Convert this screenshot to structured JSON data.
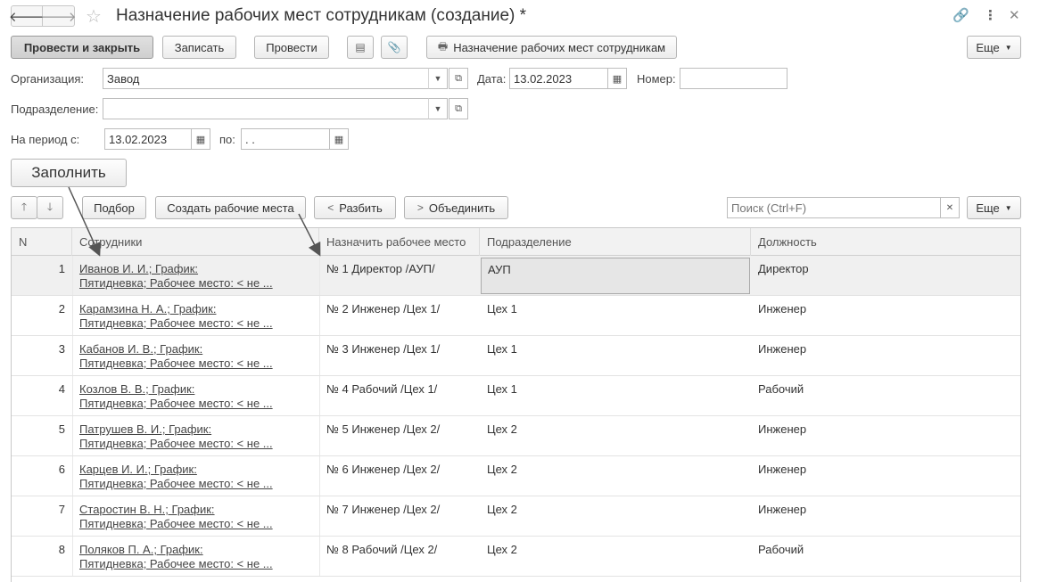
{
  "window": {
    "title": "Назначение рабочих мест сотрудникам (создание) *"
  },
  "toolbar": {
    "post_close": "Провести и закрыть",
    "save": "Записать",
    "post": "Провести",
    "print_report": "Назначение рабочих мест сотрудникам",
    "more": "Еще"
  },
  "form": {
    "org_label": "Организация:",
    "org_value": "Завод",
    "date_label": "Дата:",
    "date_value": "13.02.2023",
    "number_label": "Номер:",
    "number_value": "",
    "dept_label": "Подразделение:",
    "dept_value": "",
    "period_from_label": "На период с:",
    "period_from_value": "13.02.2023",
    "period_to_label": "по:",
    "period_to_value": " .  .",
    "fill_button": "Заполнить"
  },
  "table_toolbar": {
    "pick": "Подбор",
    "create_places": "Создать рабочие места",
    "split": "Разбить",
    "merge": "Объединить",
    "search_placeholder": "Поиск (Ctrl+F)",
    "more": "Еще"
  },
  "table": {
    "headers": [
      "N",
      "Сотрудники",
      "Назначить рабочее место",
      "Подразделение",
      "Должность"
    ],
    "rows": [
      {
        "n": "1",
        "emp1": "Иванов И. И.; График:",
        "emp2": "Пятидневка; Рабочее место: < не ...",
        "place": "№ 1 Директор /АУП/",
        "dept": "АУП",
        "pos": "Директор"
      },
      {
        "n": "2",
        "emp1": "Карамзина Н. А.; График:",
        "emp2": "Пятидневка; Рабочее место: < не ...",
        "place": "№ 2 Инженер /Цех 1/",
        "dept": "Цех 1",
        "pos": "Инженер"
      },
      {
        "n": "3",
        "emp1": "Кабанов И. В.; График:",
        "emp2": "Пятидневка; Рабочее место: < не ...",
        "place": "№ 3 Инженер /Цех 1/",
        "dept": "Цех 1",
        "pos": "Инженер"
      },
      {
        "n": "4",
        "emp1": "Козлов В. В.; График:",
        "emp2": "Пятидневка; Рабочее место: < не ...",
        "place": "№ 4 Рабочий /Цех 1/",
        "dept": "Цех 1",
        "pos": "Рабочий"
      },
      {
        "n": "5",
        "emp1": "Патрушев В. И.; График:",
        "emp2": "Пятидневка; Рабочее место: < не ...",
        "place": "№ 5 Инженер /Цех 2/",
        "dept": "Цех 2",
        "pos": "Инженер"
      },
      {
        "n": "6",
        "emp1": "Карцев И. И.; График:",
        "emp2": "Пятидневка; Рабочее место: < не ...",
        "place": "№ 6 Инженер /Цех 2/",
        "dept": "Цех 2",
        "pos": "Инженер"
      },
      {
        "n": "7",
        "emp1": "Старостин В. Н.; График:",
        "emp2": "Пятидневка; Рабочее место: < не ...",
        "place": "№ 7 Инженер /Цех 2/",
        "dept": "Цех 2",
        "pos": "Инженер"
      },
      {
        "n": "8",
        "emp1": "Поляков П. А.; График:",
        "emp2": "Пятидневка; Рабочее место: < не ...",
        "place": "№ 8 Рабочий /Цех 2/",
        "dept": "Цех 2",
        "pos": "Рабочий"
      }
    ]
  },
  "colors": {
    "accent_arrow": "#555555",
    "selected_row": "#f0f0f0"
  }
}
